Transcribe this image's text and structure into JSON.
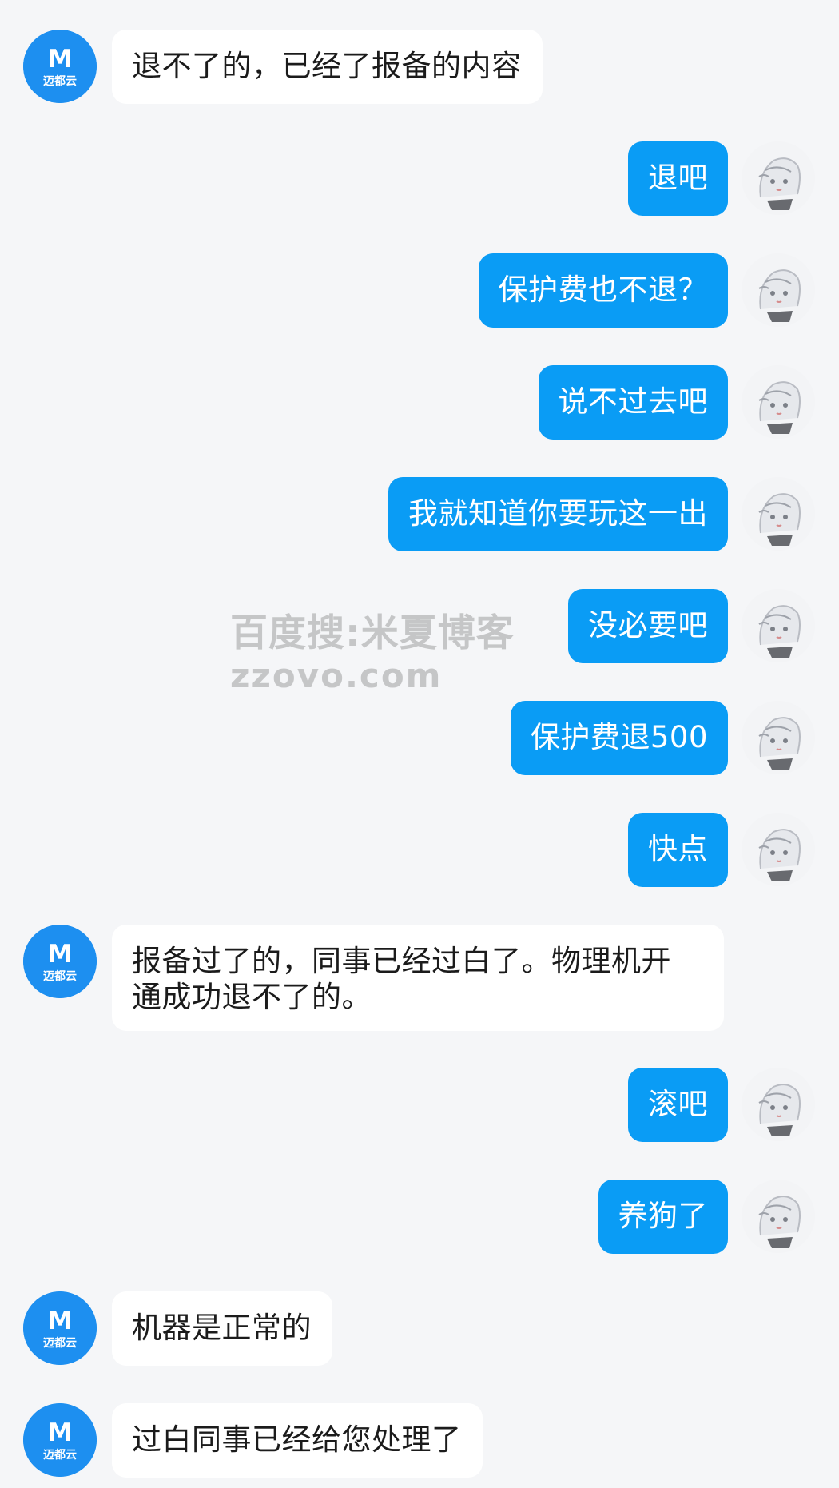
{
  "service_avatar": {
    "logo_text": "迈都云",
    "logo_mark": "M",
    "color": "#1d8ff0"
  },
  "colors": {
    "background": "#f5f6f8",
    "sent_bubble": "#0a9cf5",
    "received_bubble": "#ffffff"
  },
  "watermark": {
    "line1": "百度搜:米夏博客",
    "line2": "zzovo.com"
  },
  "messages": [
    {
      "side": "left",
      "text": "退不了的，已经了报备的内容"
    },
    {
      "side": "right",
      "text": "退吧"
    },
    {
      "side": "right",
      "text": "保护费也不退？"
    },
    {
      "side": "right",
      "text": "说不过去吧"
    },
    {
      "side": "right",
      "text": "我就知道你要玩这一出"
    },
    {
      "side": "right",
      "text": "没必要吧"
    },
    {
      "side": "right",
      "text": "保护费退500"
    },
    {
      "side": "right",
      "text": "快点"
    },
    {
      "side": "left",
      "text": "报备过了的，同事已经过白了。物理机开\n通成功退不了的。"
    },
    {
      "side": "right",
      "text": "滚吧"
    },
    {
      "side": "right",
      "text": "养狗了"
    },
    {
      "side": "left",
      "text": "机器是正常的"
    },
    {
      "side": "left",
      "text": "过白同事已经给您处理了"
    }
  ]
}
